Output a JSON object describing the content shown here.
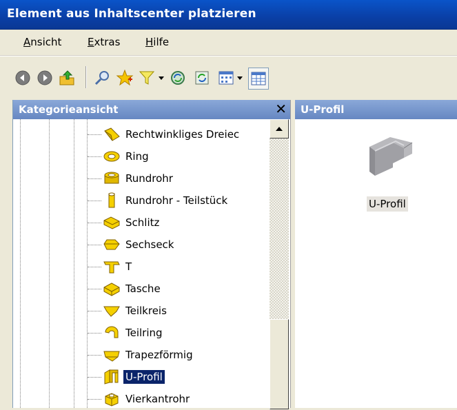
{
  "window": {
    "title": "Element aus Inhaltscenter platzieren"
  },
  "menu": [
    {
      "label": "Ansicht",
      "underline": "A",
      "rest": "nsicht"
    },
    {
      "label": "Extras",
      "underline": "E",
      "rest": "xtras"
    },
    {
      "label": "Hilfe",
      "underline": "H",
      "rest": "ilfe"
    }
  ],
  "toolbar": {
    "icons": [
      "back-icon",
      "forward-icon",
      "up-folder-icon",
      "search-icon",
      "favorites-star-icon",
      "filter-icon",
      "dropdown-arrow-icon",
      "refresh-icon",
      "update-icon",
      "view-options-icon",
      "dropdown-arrow-icon",
      "table-view-icon"
    ]
  },
  "category_pane": {
    "title": "Kategorieansicht",
    "close_label": "✕",
    "items": [
      {
        "label": "Rechtwinkliges Dreiec"
      },
      {
        "label": "Ring"
      },
      {
        "label": "Rundrohr"
      },
      {
        "label": "Rundrohr - Teilstück"
      },
      {
        "label": "Schlitz"
      },
      {
        "label": "Sechseck"
      },
      {
        "label": "T"
      },
      {
        "label": "Tasche"
      },
      {
        "label": "Teilkreis"
      },
      {
        "label": "Teilring"
      },
      {
        "label": "Trapezförmig"
      },
      {
        "label": "U-Profil",
        "selected": true
      },
      {
        "label": "Vierkantrohr"
      }
    ]
  },
  "content_pane": {
    "title": "U-Profil",
    "item_label": "U-Profil"
  },
  "colors": {
    "accent": "#0a246a",
    "titlebar": "#0a54c9",
    "pane_header": "#7596ce",
    "icon_yellow": "#f5d000"
  }
}
